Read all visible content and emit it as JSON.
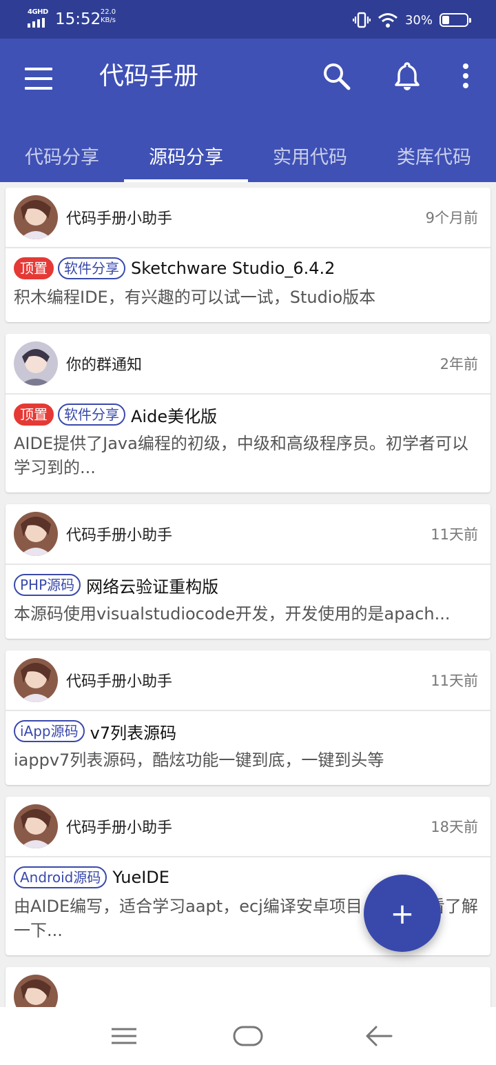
{
  "status_bar": {
    "network": "4GHD",
    "time": "15:52",
    "speed_value": "22.0",
    "speed_unit": "KB/s",
    "battery_percent": "30%",
    "battery_level": 0.3
  },
  "app_bar": {
    "title": "代码手册",
    "icons": [
      "menu-icon",
      "search-icon",
      "bell-icon",
      "more-vert-icon"
    ],
    "color": "#3f51b5"
  },
  "tabs": [
    {
      "label": "代码分享",
      "active": false
    },
    {
      "label": "源码分享",
      "active": true
    },
    {
      "label": "实用代码",
      "active": false
    },
    {
      "label": "类库代码",
      "active": false
    }
  ],
  "posts": [
    {
      "author": "代码手册小助手",
      "time": "9个月前",
      "pinned_label": "顶置",
      "category": "软件分享",
      "title": "Sketchware Studio_6.4.2",
      "description": "积木编程IDE，有兴趣的可以试一试，Studio版本"
    },
    {
      "author": "你的群通知",
      "time": "2年前",
      "pinned_label": "顶置",
      "category": "软件分享",
      "title": "Aide美化版",
      "description": "AIDE提供了Java编程的初级，中级和高级程序员。初学者可以学习到的..."
    },
    {
      "author": "代码手册小助手",
      "time": "11天前",
      "category": "PHP源码",
      "title": "网络云验证重构版",
      "description": "本源码使用visualstudiocode开发，开发使用的是apach..."
    },
    {
      "author": "代码手册小助手",
      "time": "11天前",
      "category": "iApp源码",
      "title": "v7列表源码",
      "description": "iappv7列表源码，酷炫功能一键到底，一键到头等"
    },
    {
      "author": "代码手册小助手",
      "time": "18天前",
      "category": "Android源码",
      "title": "YueIDE",
      "description": "由AIDE编写，适合学习aapt，ecj编译安卓项目，初学看看了解一下..."
    }
  ],
  "fab": {
    "label": "+"
  },
  "colors": {
    "primary": "#3f51b5",
    "status": "#2f3e94",
    "pin": "#e53935",
    "category": "#3949ab"
  }
}
